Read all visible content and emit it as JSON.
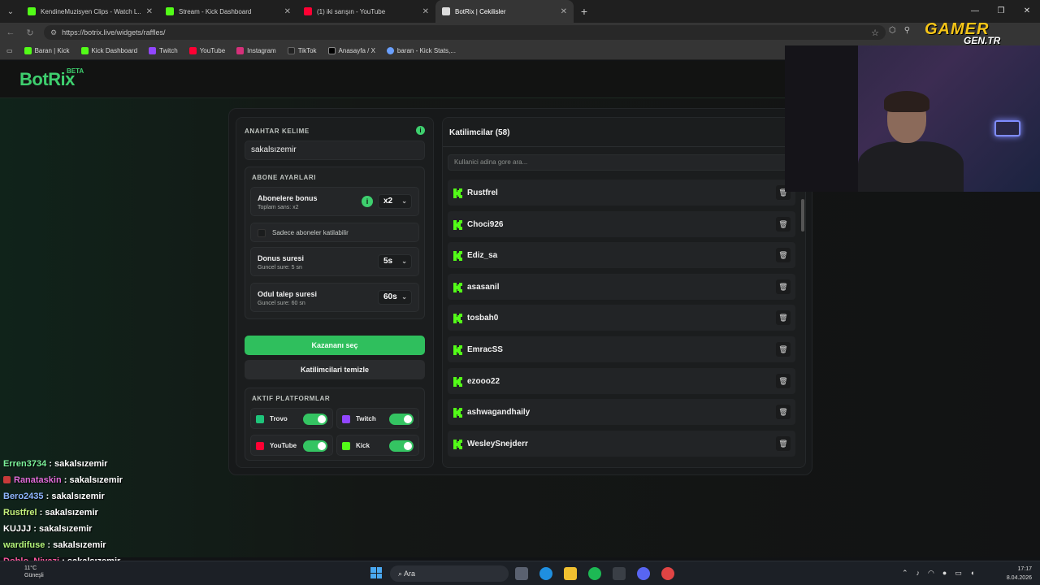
{
  "browser": {
    "tabs": [
      {
        "title": "KendineMuzisyen Clips - Watch L...",
        "color": "#53fc18"
      },
      {
        "title": "Stream - Kick Dashboard",
        "color": "#53fc18"
      },
      {
        "title": "(1) iki sarışın - YouTube",
        "color": "#ff0033"
      },
      {
        "title": "BotRix | Cekilisler",
        "color": "#dddddd"
      }
    ],
    "url": "https://botrix.live/widgets/raffles/",
    "bookmarks": [
      "Baran | Kick",
      "Kick Dashboard",
      "Twitch",
      "YouTube",
      "Instagram",
      "TikTok",
      "Anasayfa / X",
      "baran - Kick Stats,..."
    ]
  },
  "app": {
    "logo": "BotRix",
    "beta": "BETA"
  },
  "settings": {
    "keyword_label": "ANAHTAR KELIME",
    "keyword_value": "sakalsızemir",
    "subscriber_section": "ABONE AYARLARI",
    "sub_bonus": {
      "title": "Abonelere bonus",
      "subtitle": "Toplam sans: x2",
      "value": "x2"
    },
    "sub_only": "Sadece aboneler katilabilir",
    "spin_time": {
      "title": "Donus suresi",
      "subtitle": "Guncel sure: 5 sn",
      "value": "5s"
    },
    "claim_time": {
      "title": "Odul talep suresi",
      "subtitle": "Guncel sure: 60 sn",
      "value": "60s"
    },
    "pick_winner": "Kazananı seç",
    "clear_participants": "Katilimcilari temizle",
    "platforms_label": "AKTIF PLATFORMLAR",
    "platforms": [
      {
        "name": "Trovo",
        "color": "#1ec47a",
        "enabled": true
      },
      {
        "name": "Twitch",
        "color": "#9146ff",
        "enabled": true
      },
      {
        "name": "YouTube",
        "color": "#ff0033",
        "enabled": true
      },
      {
        "name": "Kick",
        "color": "#53fc18",
        "enabled": true
      }
    ]
  },
  "participants": {
    "title": "Katilimcilar (58)",
    "search_placeholder": "Kullanici adina gore ara...",
    "list": [
      "Rustfrel",
      "Choci926",
      "Ediz_sa",
      "asasanil",
      "tosbah0",
      "EmracSS",
      "ezooo22",
      "ashwagandhaily",
      "WesleySnejderr"
    ]
  },
  "overlay": {
    "brand_top": "GAMER",
    "brand_bottom": "GEN.TR",
    "chat": [
      {
        "user": "Erren3734",
        "msg": "sakalsızemir",
        "color": "#7cf29a",
        "badge": false
      },
      {
        "user": "Ranataskin",
        "msg": "sakalsızemir",
        "color": "#e06bd8",
        "badge": true
      },
      {
        "user": "Bero2435",
        "msg": "sakalsızemir",
        "color": "#8fb6ff",
        "badge": false
      },
      {
        "user": "Rustfrel",
        "msg": "sakalsızemir",
        "color": "#c6f27c",
        "badge": false
      },
      {
        "user": "KUJJJ",
        "msg": "sakalsızemir",
        "color": "#ffffff",
        "badge": false
      },
      {
        "user": "wardifuse",
        "msg": "sakalsızemir",
        "color": "#b4f57a",
        "badge": false
      },
      {
        "user": "Doblo_Niyazi",
        "msg": "sakalsızemir",
        "color": "#ff5aa0",
        "badge": false
      }
    ]
  },
  "taskbar": {
    "temp": "11°C",
    "weather": "Güneşli",
    "search": "Ara",
    "time": "17:17",
    "date": "8.04.2026"
  }
}
